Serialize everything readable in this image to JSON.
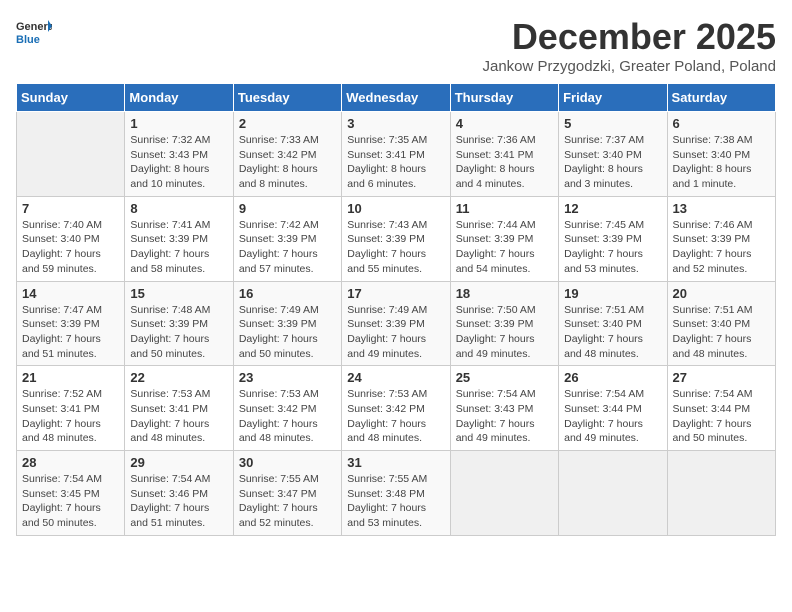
{
  "logo": {
    "general": "General",
    "blue": "Blue"
  },
  "header": {
    "month": "December 2025",
    "location": "Jankow Przygodzki, Greater Poland, Poland"
  },
  "days_header": [
    "Sunday",
    "Monday",
    "Tuesday",
    "Wednesday",
    "Thursday",
    "Friday",
    "Saturday"
  ],
  "weeks": [
    [
      {
        "day": "",
        "empty": true
      },
      {
        "day": "1",
        "sunrise": "Sunrise: 7:32 AM",
        "sunset": "Sunset: 3:43 PM",
        "daylight": "Daylight: 8 hours and 10 minutes."
      },
      {
        "day": "2",
        "sunrise": "Sunrise: 7:33 AM",
        "sunset": "Sunset: 3:42 PM",
        "daylight": "Daylight: 8 hours and 8 minutes."
      },
      {
        "day": "3",
        "sunrise": "Sunrise: 7:35 AM",
        "sunset": "Sunset: 3:41 PM",
        "daylight": "Daylight: 8 hours and 6 minutes."
      },
      {
        "day": "4",
        "sunrise": "Sunrise: 7:36 AM",
        "sunset": "Sunset: 3:41 PM",
        "daylight": "Daylight: 8 hours and 4 minutes."
      },
      {
        "day": "5",
        "sunrise": "Sunrise: 7:37 AM",
        "sunset": "Sunset: 3:40 PM",
        "daylight": "Daylight: 8 hours and 3 minutes."
      },
      {
        "day": "6",
        "sunrise": "Sunrise: 7:38 AM",
        "sunset": "Sunset: 3:40 PM",
        "daylight": "Daylight: 8 hours and 1 minute."
      }
    ],
    [
      {
        "day": "7",
        "sunrise": "Sunrise: 7:40 AM",
        "sunset": "Sunset: 3:40 PM",
        "daylight": "Daylight: 7 hours and 59 minutes."
      },
      {
        "day": "8",
        "sunrise": "Sunrise: 7:41 AM",
        "sunset": "Sunset: 3:39 PM",
        "daylight": "Daylight: 7 hours and 58 minutes."
      },
      {
        "day": "9",
        "sunrise": "Sunrise: 7:42 AM",
        "sunset": "Sunset: 3:39 PM",
        "daylight": "Daylight: 7 hours and 57 minutes."
      },
      {
        "day": "10",
        "sunrise": "Sunrise: 7:43 AM",
        "sunset": "Sunset: 3:39 PM",
        "daylight": "Daylight: 7 hours and 55 minutes."
      },
      {
        "day": "11",
        "sunrise": "Sunrise: 7:44 AM",
        "sunset": "Sunset: 3:39 PM",
        "daylight": "Daylight: 7 hours and 54 minutes."
      },
      {
        "day": "12",
        "sunrise": "Sunrise: 7:45 AM",
        "sunset": "Sunset: 3:39 PM",
        "daylight": "Daylight: 7 hours and 53 minutes."
      },
      {
        "day": "13",
        "sunrise": "Sunrise: 7:46 AM",
        "sunset": "Sunset: 3:39 PM",
        "daylight": "Daylight: 7 hours and 52 minutes."
      }
    ],
    [
      {
        "day": "14",
        "sunrise": "Sunrise: 7:47 AM",
        "sunset": "Sunset: 3:39 PM",
        "daylight": "Daylight: 7 hours and 51 minutes."
      },
      {
        "day": "15",
        "sunrise": "Sunrise: 7:48 AM",
        "sunset": "Sunset: 3:39 PM",
        "daylight": "Daylight: 7 hours and 50 minutes."
      },
      {
        "day": "16",
        "sunrise": "Sunrise: 7:49 AM",
        "sunset": "Sunset: 3:39 PM",
        "daylight": "Daylight: 7 hours and 50 minutes."
      },
      {
        "day": "17",
        "sunrise": "Sunrise: 7:49 AM",
        "sunset": "Sunset: 3:39 PM",
        "daylight": "Daylight: 7 hours and 49 minutes."
      },
      {
        "day": "18",
        "sunrise": "Sunrise: 7:50 AM",
        "sunset": "Sunset: 3:39 PM",
        "daylight": "Daylight: 7 hours and 49 minutes."
      },
      {
        "day": "19",
        "sunrise": "Sunrise: 7:51 AM",
        "sunset": "Sunset: 3:40 PM",
        "daylight": "Daylight: 7 hours and 48 minutes."
      },
      {
        "day": "20",
        "sunrise": "Sunrise: 7:51 AM",
        "sunset": "Sunset: 3:40 PM",
        "daylight": "Daylight: 7 hours and 48 minutes."
      }
    ],
    [
      {
        "day": "21",
        "sunrise": "Sunrise: 7:52 AM",
        "sunset": "Sunset: 3:41 PM",
        "daylight": "Daylight: 7 hours and 48 minutes."
      },
      {
        "day": "22",
        "sunrise": "Sunrise: 7:53 AM",
        "sunset": "Sunset: 3:41 PM",
        "daylight": "Daylight: 7 hours and 48 minutes."
      },
      {
        "day": "23",
        "sunrise": "Sunrise: 7:53 AM",
        "sunset": "Sunset: 3:42 PM",
        "daylight": "Daylight: 7 hours and 48 minutes."
      },
      {
        "day": "24",
        "sunrise": "Sunrise: 7:53 AM",
        "sunset": "Sunset: 3:42 PM",
        "daylight": "Daylight: 7 hours and 48 minutes."
      },
      {
        "day": "25",
        "sunrise": "Sunrise: 7:54 AM",
        "sunset": "Sunset: 3:43 PM",
        "daylight": "Daylight: 7 hours and 49 minutes."
      },
      {
        "day": "26",
        "sunrise": "Sunrise: 7:54 AM",
        "sunset": "Sunset: 3:44 PM",
        "daylight": "Daylight: 7 hours and 49 minutes."
      },
      {
        "day": "27",
        "sunrise": "Sunrise: 7:54 AM",
        "sunset": "Sunset: 3:44 PM",
        "daylight": "Daylight: 7 hours and 50 minutes."
      }
    ],
    [
      {
        "day": "28",
        "sunrise": "Sunrise: 7:54 AM",
        "sunset": "Sunset: 3:45 PM",
        "daylight": "Daylight: 7 hours and 50 minutes."
      },
      {
        "day": "29",
        "sunrise": "Sunrise: 7:54 AM",
        "sunset": "Sunset: 3:46 PM",
        "daylight": "Daylight: 7 hours and 51 minutes."
      },
      {
        "day": "30",
        "sunrise": "Sunrise: 7:55 AM",
        "sunset": "Sunset: 3:47 PM",
        "daylight": "Daylight: 7 hours and 52 minutes."
      },
      {
        "day": "31",
        "sunrise": "Sunrise: 7:55 AM",
        "sunset": "Sunset: 3:48 PM",
        "daylight": "Daylight: 7 hours and 53 minutes."
      },
      {
        "day": "",
        "empty": true
      },
      {
        "day": "",
        "empty": true
      },
      {
        "day": "",
        "empty": true
      }
    ]
  ]
}
